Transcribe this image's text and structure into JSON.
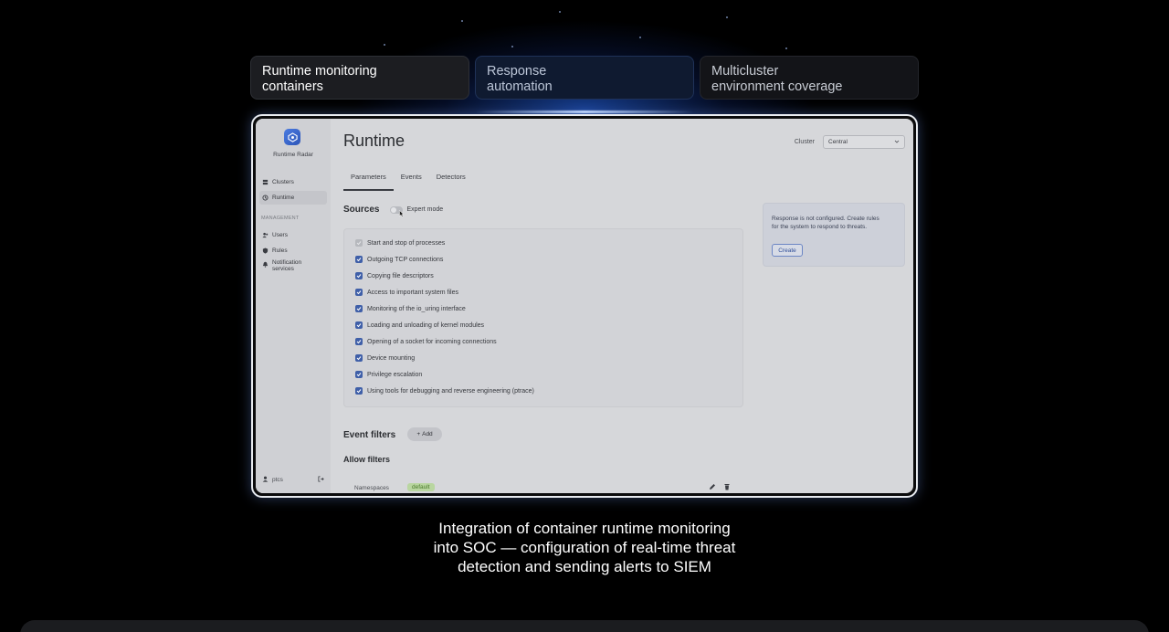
{
  "feature_tabs": [
    {
      "line1": "Runtime monitoring",
      "line2": "containers"
    },
    {
      "line1": "Response",
      "line2": "automation"
    },
    {
      "line1": "Multicluster",
      "line2": "environment coverage"
    }
  ],
  "app": {
    "name": "Runtime Radar",
    "nav": {
      "clusters": "Clusters",
      "runtime": "Runtime",
      "section": "MANAGEMENT",
      "users": "Users",
      "rules": "Rules",
      "notifications_line1": "Notification",
      "notifications_line2": "services"
    },
    "user": "ptcs",
    "page_title": "Runtime",
    "cluster_label": "Cluster",
    "cluster_value": "Central",
    "tabs": [
      "Parameters",
      "Events",
      "Detectors"
    ],
    "sources_title": "Sources",
    "expert_mode": "Expert mode",
    "sources": [
      "Start and stop of processes",
      "Outgoing TCP connections",
      "Copying file descriptors",
      "Access to important system files",
      "Monitoring of the io_uring interface",
      "Loading and unloading of kernel modules",
      "Opening of a socket for incoming connections",
      "Device mounting",
      "Privilege escalation",
      "Using tools for debugging and reverse engineering (ptrace)"
    ],
    "alert_line1": "Response is not configured. Create rules",
    "alert_line2": "for the system to respond to threats.",
    "create_label": "Create",
    "event_filters_title": "Event filters",
    "add_label": "Add",
    "allow_filters_title": "Allow filters",
    "namespaces_label": "Namespaces",
    "namespace_value": "default"
  },
  "caption": {
    "line1": "Integration of container runtime monitoring",
    "line2": "into SOC — configuration of real-time threat",
    "line3": "detection and sending alerts to SIEM"
  },
  "colors": {
    "accent": "#3f5fa8",
    "glow": "#2f6bff",
    "background": "#000000"
  }
}
